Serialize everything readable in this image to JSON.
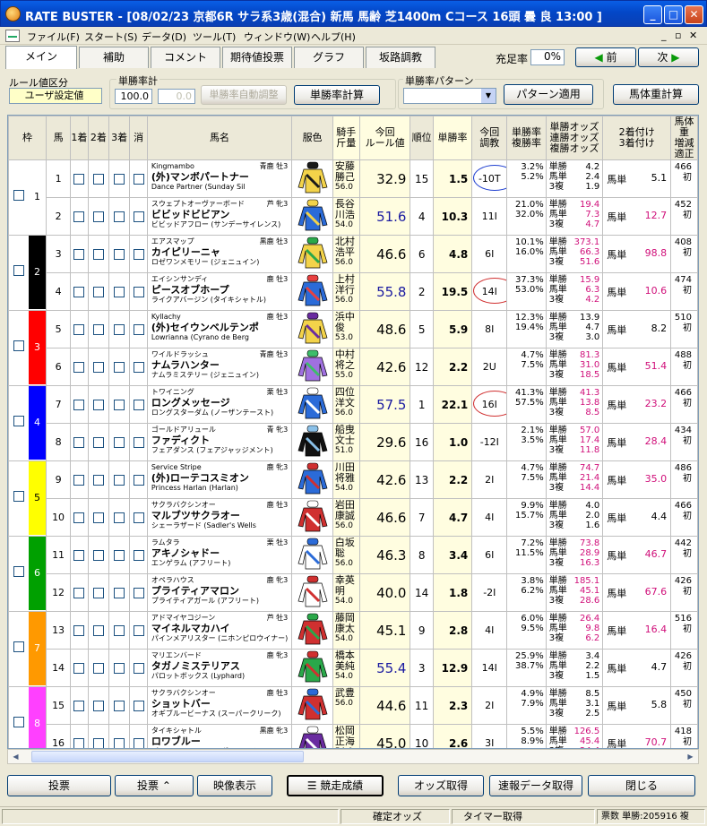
{
  "window": {
    "title": "RATE BUSTER - [08/02/23 京都6R サラ系3歳(混合) 新馬 馬齢 芝1400m Cコース 16頭 曇 良 13:00 ]",
    "minimize": "_",
    "maximize": "□",
    "close": "✕"
  },
  "menu": {
    "items": [
      "ファイル(F)",
      "スタート(S)",
      "データ(D)",
      "ツール(T)",
      "ウィンドウ(W)",
      "ヘルプ(H)"
    ],
    "mdi_min": "_",
    "mdi_restore": "▫",
    "mdi_close": "✕"
  },
  "tabs": [
    "メイン",
    "補助",
    "コメント",
    "期待値投票",
    "グラフ",
    "坂路調教"
  ],
  "top": {
    "juteiritsu_label": "充足率",
    "juteiritsu_value": "0%",
    "prev_label": "前",
    "next_label": "次"
  },
  "rule_group": {
    "label": "ルール値区分",
    "value": "ユーザ設定値"
  },
  "tansho_group": {
    "label": "単勝率計",
    "value1": "100.0",
    "value2": "0.0",
    "auto_button": "単勝率自動調整",
    "calc_button": "単勝率計算"
  },
  "pattern_group": {
    "label": "単勝率パターン",
    "apply_button": "パターン適用"
  },
  "weight_button": "馬体重計算",
  "headers": {
    "waku": "枠",
    "uma": "馬",
    "c1": "1着",
    "c2": "2着",
    "c3": "3着",
    "kesu": "消",
    "name": "馬名",
    "color": "服色",
    "jockey": "騎手\n斤量",
    "rule": "今回\nルール値",
    "rank": "順位",
    "winrate": "単勝率",
    "choukyo": "今回\n調教",
    "pct": "単勝率\n複勝率",
    "odds": "単勝オッズ\n連勝オッズ\n複勝オッズ",
    "bt": "2着付け\n3着付け",
    "bw": "馬体重\n増減\n適正"
  },
  "horses": [
    {
      "waku": "1",
      "uma": "1",
      "sire": "Kingmambo",
      "sex": "青鹿 牡3",
      "name": "(外)マンボパートナー",
      "dam": "Dance Partner (Sunday Sil",
      "jockey": "安藤\n勝己",
      "weight": "56.0",
      "rule": "32.9",
      "rank": "15",
      "wr": "1.5",
      "ck": "-10T",
      "win_pct": "3.2%",
      "place_pct": "5.2%",
      "odds_t": "4.2",
      "odds_r": "2.4",
      "odds_f": "1.9",
      "bt_value": "5.1",
      "bw1": "466",
      "bw2": "初"
    },
    {
      "waku": "1",
      "uma": "2",
      "sire": "スウェプトオーヴァーボード",
      "sex": "芦 牝3",
      "name": "ビビッドビビアン",
      "dam": "ビビッドアフロー (サンデーサイレンス)",
      "jockey": "長谷\n川浩",
      "weight": "54.0",
      "rule": "51.6",
      "rank": "4",
      "wr": "10.3",
      "ck": "11I",
      "win_pct": "21.0%",
      "place_pct": "32.0%",
      "odds_t": "19.4",
      "odds_r": "7.3",
      "odds_f": "4.7",
      "bt_value": "12.7",
      "bw1": "452",
      "bw2": "初"
    },
    {
      "waku": "2",
      "uma": "3",
      "sire": "エアスマップ",
      "sex": "黒鹿 牡3",
      "name": "カイピリーニャ",
      "dam": "ロゼワンメモリー (ジェニュイン)",
      "jockey": "北村\n浩平",
      "weight": "56.0",
      "rule": "46.6",
      "rank": "6",
      "wr": "4.8",
      "ck": "6I",
      "win_pct": "10.1%",
      "place_pct": "16.0%",
      "odds_t": "373.1",
      "odds_r": "66.3",
      "odds_f": "51.6",
      "bt_value": "98.8",
      "bw1": "408",
      "bw2": "初"
    },
    {
      "waku": "2",
      "uma": "4",
      "sire": "エイシンサンディ",
      "sex": "鹿 牡3",
      "name": "ピースオブホープ",
      "dam": "ライクアバージン (タイキシャトル)",
      "jockey": "上村\n洋行",
      "weight": "56.0",
      "rule": "55.8",
      "rank": "2",
      "wr": "19.5",
      "ck": "14I",
      "win_pct": "37.3%",
      "place_pct": "53.0%",
      "odds_t": "15.9",
      "odds_r": "6.3",
      "odds_f": "4.2",
      "bt_value": "10.6",
      "bw1": "474",
      "bw2": "初"
    },
    {
      "waku": "3",
      "uma": "5",
      "sire": "Kyllachy",
      "sex": "鹿 牡3",
      "name": "(外)セイウンベルテンポ",
      "dam": "Lowrianna (Cyrano de Berg",
      "jockey": "浜中\n俊",
      "weight": "53.0",
      "rule": "48.6",
      "rank": "5",
      "wr": "5.9",
      "ck": "8I",
      "win_pct": "12.3%",
      "place_pct": "19.4%",
      "odds_t": "13.9",
      "odds_r": "4.7",
      "odds_f": "3.0",
      "bt_value": "8.2",
      "bw1": "510",
      "bw2": "初"
    },
    {
      "waku": "3",
      "uma": "6",
      "sire": "ワイルドラッシュ",
      "sex": "青鹿 牡3",
      "name": "ナムラハンター",
      "dam": "ナムラミステリー (ジェニュイン)",
      "jockey": "中村\n将之",
      "weight": "55.0",
      "rule": "42.6",
      "rank": "12",
      "wr": "2.2",
      "ck": "2U",
      "win_pct": "4.7%",
      "place_pct": "7.5%",
      "odds_t": "81.3",
      "odds_r": "31.0",
      "odds_f": "18.5",
      "bt_value": "51.4",
      "bw1": "488",
      "bw2": "初"
    },
    {
      "waku": "4",
      "uma": "7",
      "sire": "トワイニング",
      "sex": "栗 牡3",
      "name": "ロングメッセージ",
      "dam": "ロングスターダム (ノーザンテースト)",
      "jockey": "四位\n洋文",
      "weight": "56.0",
      "rule": "57.5",
      "rank": "1",
      "wr": "22.1",
      "ck": "16I",
      "win_pct": "41.3%",
      "place_pct": "57.5%",
      "odds_t": "41.3",
      "odds_r": "13.8",
      "odds_f": "8.5",
      "bt_value": "23.2",
      "bw1": "466",
      "bw2": "初"
    },
    {
      "waku": "4",
      "uma": "8",
      "sire": "ゴールドアリュール",
      "sex": "青 牝3",
      "name": "ファディクト",
      "dam": "フェアダンス (フェアジャッジメント)",
      "jockey": "船曳\n文士",
      "weight": "51.0",
      "rule": "29.6",
      "rank": "16",
      "wr": "1.0",
      "ck": "-12I",
      "win_pct": "2.1%",
      "place_pct": "3.5%",
      "odds_t": "57.0",
      "odds_r": "17.4",
      "odds_f": "11.8",
      "bt_value": "28.4",
      "bw1": "434",
      "bw2": "初"
    },
    {
      "waku": "5",
      "uma": "9",
      "sire": "Service Stripe",
      "sex": "鹿 牝3",
      "name": "(外)ローテコスミオン",
      "dam": "Princess Harlan (Harlan)",
      "jockey": "川田\n将雅",
      "weight": "54.0",
      "rule": "42.6",
      "rank": "13",
      "wr": "2.2",
      "ck": "2I",
      "win_pct": "4.7%",
      "place_pct": "7.5%",
      "odds_t": "74.7",
      "odds_r": "21.4",
      "odds_f": "14.4",
      "bt_value": "35.0",
      "bw1": "486",
      "bw2": "初"
    },
    {
      "waku": "5",
      "uma": "10",
      "sire": "サクラバクシンオー",
      "sex": "鹿 牡3",
      "name": "マルブツサクラオー",
      "dam": "シェーラザード (Sadler's Wells",
      "jockey": "岩田\n康誠",
      "weight": "56.0",
      "rule": "46.6",
      "rank": "7",
      "wr": "4.7",
      "ck": "4I",
      "win_pct": "9.9%",
      "place_pct": "15.7%",
      "odds_t": "4.0",
      "odds_r": "2.0",
      "odds_f": "1.6",
      "bt_value": "4.4",
      "bw1": "466",
      "bw2": "初"
    },
    {
      "waku": "6",
      "uma": "11",
      "sire": "ラムタラ",
      "sex": "栗 牡3",
      "name": "アキノシャドー",
      "dam": "エンゲラム (アフリート)",
      "jockey": "白坂\n聡",
      "weight": "56.0",
      "rule": "46.3",
      "rank": "8",
      "wr": "3.4",
      "ck": "6I",
      "win_pct": "7.2%",
      "place_pct": "11.5%",
      "odds_t": "73.8",
      "odds_r": "28.9",
      "odds_f": "16.3",
      "bt_value": "46.7",
      "bw1": "442",
      "bw2": "初"
    },
    {
      "waku": "6",
      "uma": "12",
      "sire": "オペラハウス",
      "sex": "鹿 牝3",
      "name": "プライティアマロン",
      "dam": "プライティアガール (アフリート)",
      "jockey": "幸英\n明",
      "weight": "54.0",
      "rule": "40.0",
      "rank": "14",
      "wr": "1.8",
      "ck": "-2I",
      "win_pct": "3.8%",
      "place_pct": "6.2%",
      "odds_t": "185.1",
      "odds_r": "45.1",
      "odds_f": "28.6",
      "bt_value": "67.6",
      "bw1": "426",
      "bw2": "初"
    },
    {
      "waku": "7",
      "uma": "13",
      "sire": "アドマイヤコジーン",
      "sex": "芦 牡3",
      "name": "マイネルマカハイ",
      "dam": "パインメアリスター (ニホンピロウイナー)",
      "jockey": "藤岡\n康太",
      "weight": "54.0",
      "rule": "45.1",
      "rank": "9",
      "wr": "2.8",
      "ck": "4I",
      "win_pct": "6.0%",
      "place_pct": "9.5%",
      "odds_t": "26.4",
      "odds_r": "9.8",
      "odds_f": "6.2",
      "bt_value": "16.4",
      "bw1": "516",
      "bw2": "初"
    },
    {
      "waku": "7",
      "uma": "14",
      "sire": "マリエンバード",
      "sex": "鹿 牝3",
      "name": "タガノミステリアス",
      "dam": "パロットボックス (Lyphard)",
      "jockey": "橋本\n美純",
      "weight": "54.0",
      "rule": "55.4",
      "rank": "3",
      "wr": "12.9",
      "ck": "14I",
      "win_pct": "25.9%",
      "place_pct": "38.7%",
      "odds_t": "3.4",
      "odds_r": "2.2",
      "odds_f": "1.5",
      "bt_value": "4.7",
      "bw1": "426",
      "bw2": "初"
    },
    {
      "waku": "8",
      "uma": "15",
      "sire": "サクラバクシンオー",
      "sex": "鹿 牡3",
      "name": "ショットバー",
      "dam": "オギブルービーナス (スーパークリーク)",
      "jockey": "武豊",
      "weight": "56.0",
      "rule": "44.6",
      "rank": "11",
      "wr": "2.3",
      "ck": "2I",
      "win_pct": "4.9%",
      "place_pct": "7.9%",
      "odds_t": "8.5",
      "odds_r": "3.1",
      "odds_f": "2.5",
      "bt_value": "5.8",
      "bw1": "450",
      "bw2": "初"
    },
    {
      "waku": "8",
      "uma": "16",
      "sire": "タイキシャトル",
      "sex": "黒鹿 牝3",
      "name": "ロワブルー",
      "dam": "パントラロード (マンダーイーチーフ)",
      "jockey": "松岡\n正海",
      "weight": "54.0",
      "rule": "45.0",
      "rank": "10",
      "wr": "2.6",
      "ck": "3I",
      "win_pct": "5.5%",
      "place_pct": "8.9%",
      "odds_t": "126.5",
      "odds_r": "45.4",
      "odds_f": "24.4",
      "bt_value": "70.7",
      "bw1": "418",
      "bw2": "初"
    }
  ],
  "odds_labels": [
    "単勝",
    "馬単",
    "3複"
  ],
  "bt_label": "馬単",
  "bottom_buttons": [
    "投票",
    "投票",
    "映像表示",
    "競走成績",
    "オッズ取得",
    "速報データ取得",
    "閉じる"
  ],
  "status": {
    "p1": "確定オッズ",
    "p2": "タイマー取得",
    "p3": "票数 単勝:205916 複"
  },
  "colors": {
    "waku": [
      "#ffffff",
      "#000000",
      "#ff0000",
      "#0000ff",
      "#ffff00",
      "#00a000",
      "#ff9900",
      "#ff40ff"
    ],
    "rule_value": "#1a1aa0",
    "odds_pink": "#d0107a",
    "ellipse_red": "#d03030",
    "ellipse_blue": "#2040d0",
    "title_bar": "#0a5ee6"
  }
}
